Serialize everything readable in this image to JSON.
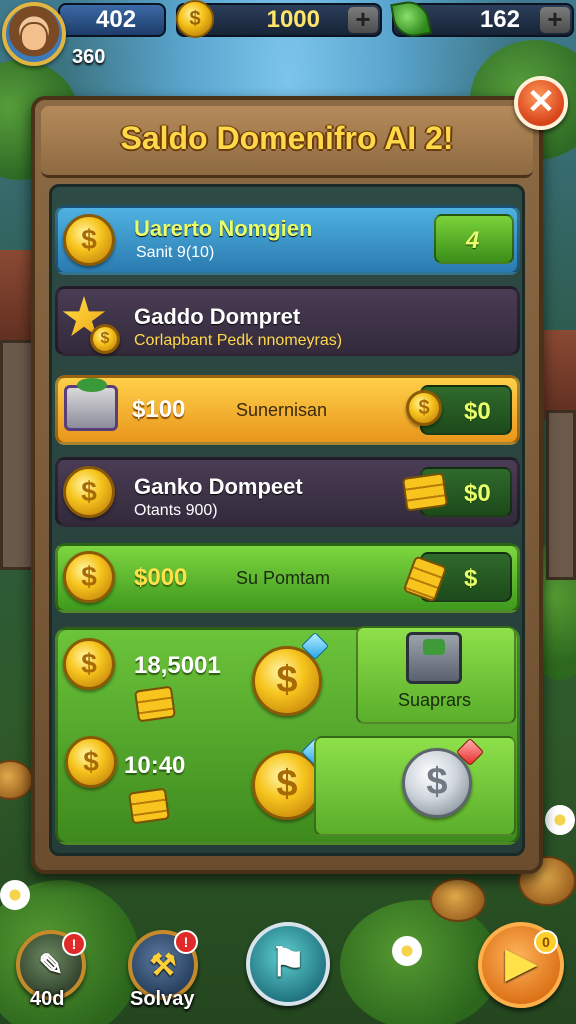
{
  "hud": {
    "level": "402",
    "xp": "360",
    "coins": "1000",
    "gems": "162",
    "plus_symbol": "+"
  },
  "panel": {
    "title": "Saldo Domenifro AI 2!",
    "close_symbol": "✕"
  },
  "rows": [
    {
      "title": "Uarerto Nomgien",
      "subtitle": "Sanit 9(10)",
      "button": "4"
    },
    {
      "title": "Gaddo Dompret",
      "subtitle": "Corlapbant Pedk nnomeyras)"
    },
    {
      "value": "$100",
      "label": "Sunernisan",
      "button": "$0"
    },
    {
      "title": "Ganko Dompeet",
      "subtitle": "Otants 900)",
      "button": "$0"
    },
    {
      "value": "$000",
      "label": "Su Pomtam",
      "button": "$"
    }
  ],
  "bottom_card": {
    "value_1": "18,5001",
    "value_2": "10:40",
    "chest_label": "Suaprars"
  },
  "nav": [
    {
      "label": "40d",
      "badge": "!"
    },
    {
      "label": "Solvay",
      "badge": "!"
    },
    {
      "label": ""
    },
    {
      "label": "",
      "badge": "0"
    }
  ],
  "colors": {
    "title_gold": "#ffd84a",
    "accent_green": "#7ed640",
    "accent_blue": "#4fb2e0",
    "close_red": "#d8431a"
  },
  "icons": [
    "avatar",
    "coin-icon",
    "leaf-gem-icon",
    "plus-icon",
    "close-icon",
    "star-icon",
    "book-icon",
    "chest-icon",
    "gold-bars-icon",
    "diamond-icon",
    "silver-coin-icon",
    "play-icon"
  ]
}
